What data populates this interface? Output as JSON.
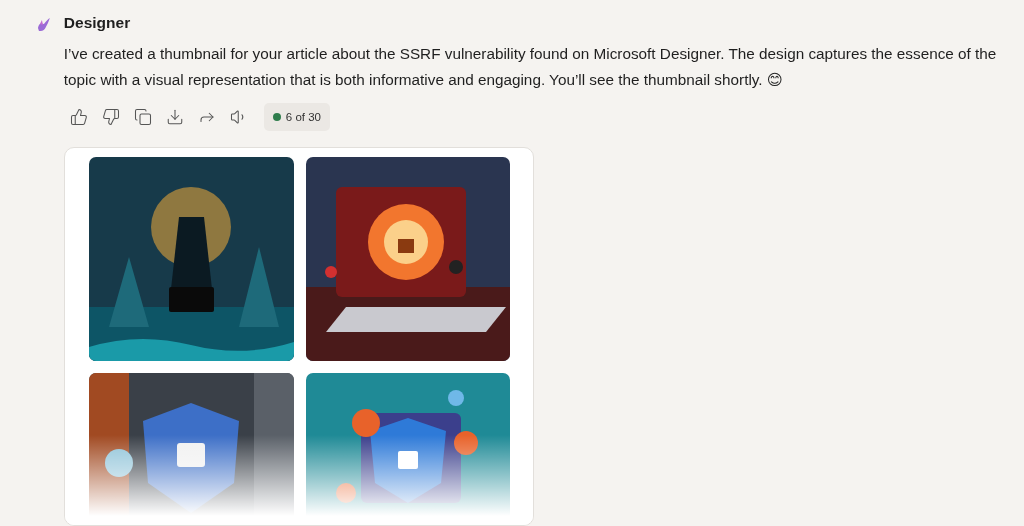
{
  "message": {
    "sender": "Designer",
    "text": "I’ve created a thumbnail for your article about the SSRF vulnerability found on Microsoft Designer. The design captures the essence of the topic with a visual representation that is both informative and engaging. You’ll see the thumbnail shortly. 😊"
  },
  "actions": [
    {
      "kind": "like"
    },
    {
      "kind": "dislike"
    },
    {
      "kind": "copy"
    },
    {
      "kind": "download"
    },
    {
      "kind": "share"
    },
    {
      "kind": "read-aloud"
    }
  ],
  "counter": "6 of 30"
}
